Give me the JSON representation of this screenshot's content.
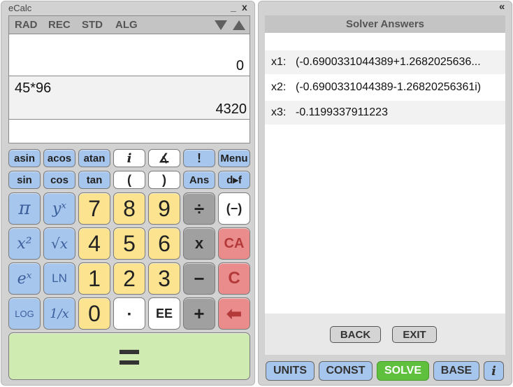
{
  "app": {
    "title": "eCalc",
    "minimize": "_",
    "close": "x",
    "collapse": "«"
  },
  "modes": {
    "rad": "RAD",
    "rec": "REC",
    "std": "STD",
    "alg": "ALG"
  },
  "display": {
    "top_result": "0",
    "expression": "45*96",
    "result": "4320",
    "input": ""
  },
  "keys": {
    "asin": "asin",
    "acos": "acos",
    "atan": "atan",
    "imag": "i",
    "angle": "∡",
    "factorial": "!",
    "menu": "Menu",
    "sin": "sin",
    "cos": "cos",
    "tan": "tan",
    "lparen": "(",
    "rparen": ")",
    "ans": "Ans",
    "dtof": "d▸f",
    "pi": "π",
    "ypow": "yˣ",
    "n7": "7",
    "n8": "8",
    "n9": "9",
    "divide": "÷",
    "negate": "(−)",
    "square": "x²",
    "sqrt": "√x",
    "n4": "4",
    "n5": "5",
    "n6": "6",
    "multiply": "x",
    "ca": "CA",
    "exp": "eˣ",
    "ln": "LN",
    "n1": "1",
    "n2": "2",
    "n3": "3",
    "minus": "−",
    "clear": "C",
    "log": "LOG",
    "recip": "1/x",
    "n0": "0",
    "dot": "▪",
    "ee": "EE",
    "plus": "+",
    "backspace": "⬅",
    "equals": "="
  },
  "solver": {
    "title": "Solver Answers",
    "answers": [
      {
        "label": "x1:",
        "value": "(-0.6900331044389+1.2682025636..."
      },
      {
        "label": "x2:",
        "value": "(-0.6900331044389-1.26820256361i)"
      },
      {
        "label": "x3:",
        "value": "-0.1199337911223"
      }
    ],
    "back": "BACK",
    "exit": "EXIT"
  },
  "nav": {
    "units": "UNITS",
    "const": "CONST",
    "solve": "SOLVE",
    "base": "BASE",
    "info": "i"
  },
  "colors": {
    "key_blue": "#a7c6ee",
    "key_yellow": "#fbe38f",
    "key_grey": "#a0a0a0",
    "key_red": "#ea8c8c",
    "equals_green": "#cfebb2",
    "solve_green": "#5fc03d"
  }
}
